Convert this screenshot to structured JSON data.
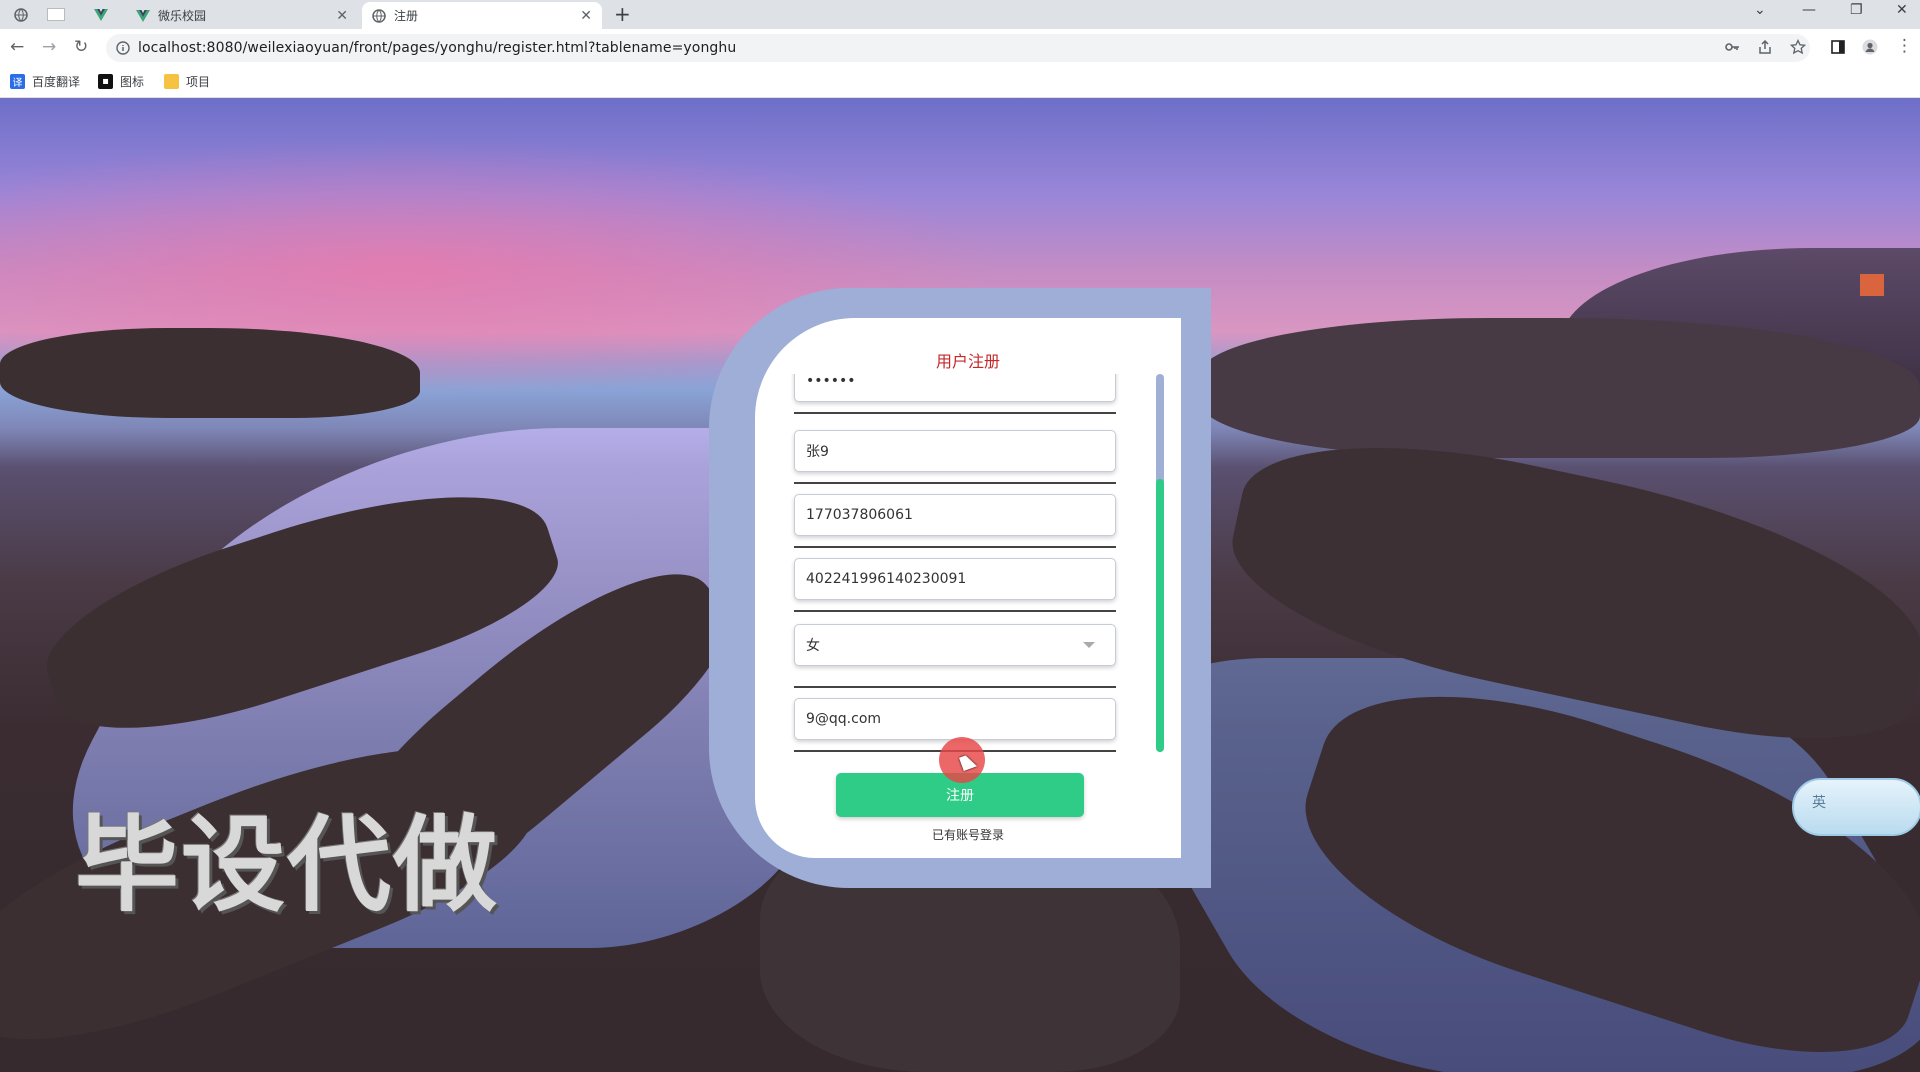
{
  "browser": {
    "tabs": [
      {
        "title": "微乐校园",
        "active": false
      },
      {
        "title": "注册",
        "active": true
      }
    ],
    "url": "localhost:8080/weilexiaoyuan/front/pages/yonghu/register.html?tablename=yonghu",
    "bookmarks": [
      {
        "label": "百度翻译",
        "icon": "translate-icon",
        "color": "#2b6de5"
      },
      {
        "label": "图标",
        "icon": "image-icon",
        "color": "#111111"
      },
      {
        "label": "项目",
        "icon": "folder-icon",
        "color": "#f5c242"
      }
    ]
  },
  "register": {
    "title": "用户注册",
    "fields": [
      {
        "name": "password-field",
        "value": "••••••"
      },
      {
        "name": "name-field",
        "value": "张9"
      },
      {
        "name": "phone-field",
        "value": "177037806061"
      },
      {
        "name": "id-card-field",
        "value": "402241996140230091"
      },
      {
        "name": "gender-select",
        "value": "女"
      },
      {
        "name": "email-field",
        "value": "9@qq.com"
      }
    ],
    "submit_label": "注册",
    "login_link": "已有账号登录"
  },
  "overlay": {
    "watermark": "毕设代做",
    "ime_label": "英"
  },
  "colors": {
    "accent": "#2ecc87",
    "title_red": "#c62828",
    "card_frame": "#9eaed6"
  }
}
